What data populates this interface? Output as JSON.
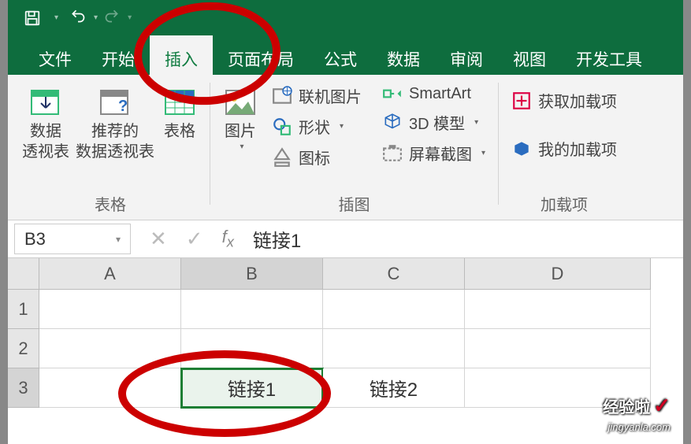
{
  "titlebar": {},
  "tabs": {
    "file": "文件",
    "home": "开始",
    "insert": "插入",
    "layout": "页面布局",
    "formula": "公式",
    "data": "数据",
    "review": "审阅",
    "view": "视图",
    "dev": "开发工具"
  },
  "ribbon": {
    "tables_group": "表格",
    "pivot": "数据\n透视表",
    "rec_pivot": "推荐的\n数据透视表",
    "table": "表格",
    "illus_group": "插图",
    "picture": "图片",
    "online_pic": "联机图片",
    "shapes": "形状",
    "icons": "图标",
    "smartart": "SmartArt",
    "model3d": "3D 模型",
    "screenshot": "屏幕截图",
    "addins_group": "加载项",
    "get_addins": "获取加载项",
    "my_addins": "我的加载项"
  },
  "namebox": {
    "value": "B3"
  },
  "formula_bar": {
    "value": "链接1"
  },
  "columns": [
    "A",
    "B",
    "C",
    "D"
  ],
  "rows": [
    "1",
    "2",
    "3"
  ],
  "cells": {
    "B3": "链接1",
    "C3": "链接2"
  },
  "watermark": {
    "title": "经验啦",
    "url": "jingyanla.com"
  }
}
